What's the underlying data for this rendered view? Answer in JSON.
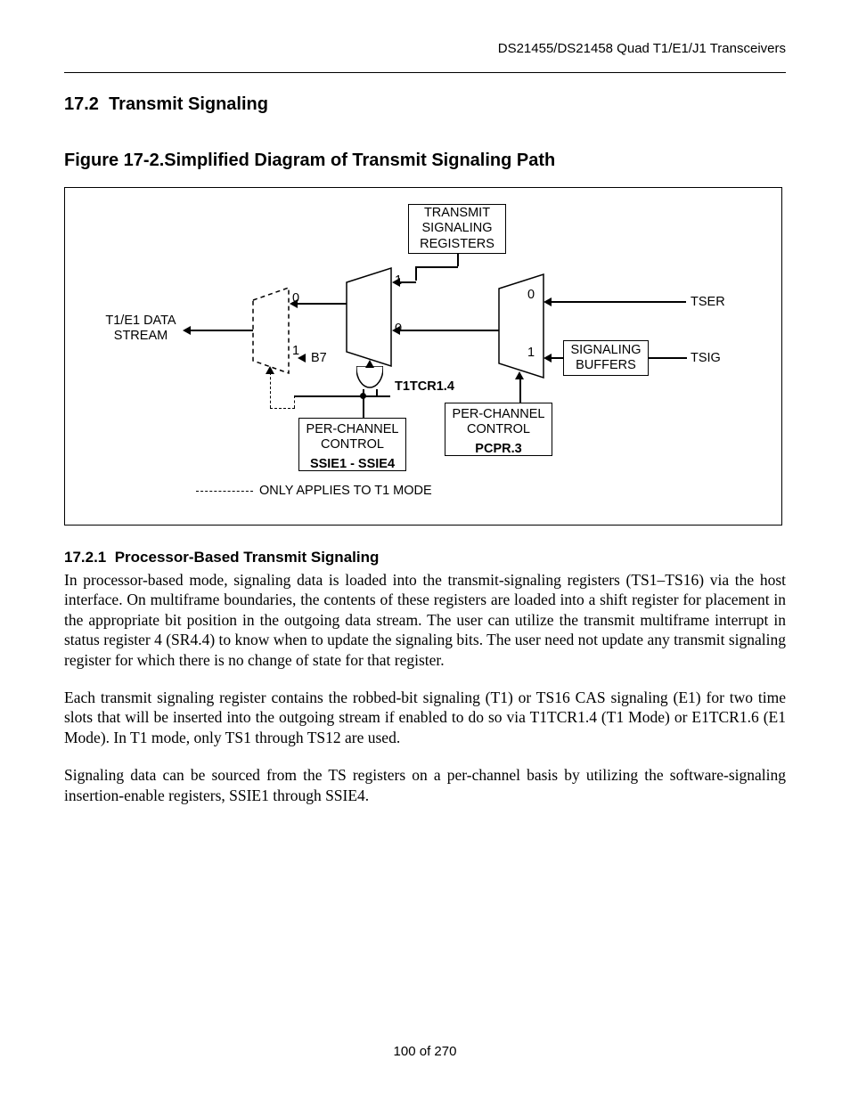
{
  "header": {
    "doc_title": "DS21455/DS21458 Quad T1/E1/J1 Transceivers"
  },
  "section": {
    "num": "17.2",
    "title": "Transmit Signaling"
  },
  "figure": {
    "num": "Figure 17-2.",
    "title": "Simplified Diagram of Transmit Signaling Path"
  },
  "diagram": {
    "tx_sig_reg": "TRANSMIT\nSIGNALING\nREGISTERS",
    "data_stream": "T1/E1 DATA\nSTREAM",
    "sig_buffers": "SIGNALING\nBUFFERS",
    "tser": "TSER",
    "tsig": "TSIG",
    "per_ch1_l1": "PER-CHANNEL",
    "per_ch1_l2": "CONTROL",
    "per_ch1_reg": "SSIE1 - SSIE4",
    "per_ch2_l1": "PER-CHANNEL",
    "per_ch2_l2": "CONTROL",
    "per_ch2_reg": "PCPR.3",
    "t1tcr": "T1TCR1.4",
    "b7": "B7",
    "mux1_in0": "0",
    "mux1_in1": "1",
    "mux2_in0": "0",
    "mux2_in1": "1",
    "mux3_in0": "0",
    "mux3_in1": "1",
    "legend": "ONLY APPLIES TO T1 MODE"
  },
  "subsection": {
    "num": "17.2.1",
    "title": "Processor-Based Transmit Signaling"
  },
  "paragraphs": {
    "p1": "In processor-based mode, signaling data is loaded into the transmit-signaling registers (TS1–TS16) via the host interface. On multiframe boundaries, the contents of these registers are loaded into a shift register for placement in the appropriate bit position in the outgoing data stream. The user can utilize the transmit multiframe interrupt in status register 4 (SR4.4) to know when to update the signaling bits. The user need not update any transmit signaling register for which there is no change of state for that register.",
    "p2": "Each transmit signaling register contains the robbed-bit signaling (T1) or TS16 CAS signaling (E1) for two time slots that will be inserted into the outgoing stream if enabled to do so via T1TCR1.4 (T1 Mode) or E1TCR1.6 (E1 Mode). In T1 mode, only TS1 through TS12 are used.",
    "p3": "Signaling data can be sourced from the TS registers on a per-channel basis by utilizing the software-signaling insertion-enable registers, SSIE1 through SSIE4."
  },
  "footer": {
    "page": "100 of 270"
  }
}
